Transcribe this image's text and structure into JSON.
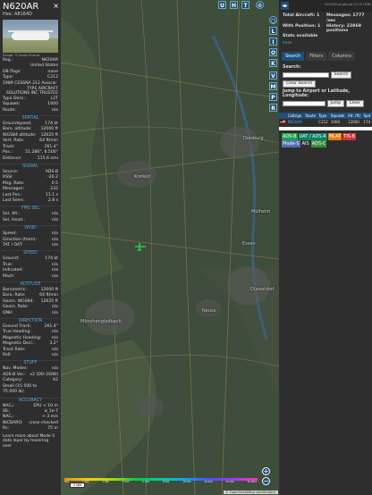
{
  "aircraft": {
    "callsign": "N620AR",
    "hex_label": "Hex:  A8164D",
    "photo_credit": "Image: © Jonas Errand"
  },
  "details": [
    {
      "k": "Reg.:",
      "v": "N620AR"
    },
    {
      "k": "",
      "v": "United States"
    },
    {
      "k": "DB flags:",
      "v": "none"
    },
    {
      "k": "Type:",
      "v": "C212"
    },
    {
      "k": "1989 CESSNA 212 Aviocar",
      "v": ""
    }
  ],
  "owner_lines": [
    "TYPE AIRCRAFT",
    "SOLUTIONS INC TRUSTEE"
  ],
  "details2": [
    {
      "k": "Type Desc.:",
      "v": "L2T"
    },
    {
      "k": "Squawk:",
      "v": "1000"
    },
    {
      "k": "Route:",
      "v": "n/a"
    }
  ],
  "sections": {
    "spatial": "SPATIAL",
    "signal": "SIGNAL",
    "fms_sel": "FMS SEL",
    "wind": "WIND",
    "speed": "SPEED",
    "altitude": "ALTITUDE",
    "direction": "DIRECTION",
    "stuff": "STUFF",
    "accuracy": "ACCURACY"
  },
  "spatial": [
    {
      "k": "Groundspeed:",
      "v": "174 kt"
    },
    {
      "k": "Baro. altitude:",
      "v": "12000 ft"
    },
    {
      "k": "WGS84 altitude:",
      "v": "12625 ft"
    },
    {
      "k": "Vert. Rate:",
      "v": "64 ft/min"
    },
    {
      "k": "Track:",
      "v": "261.4°"
    },
    {
      "k": "Pos.:",
      "v": "51.286°, 6.500°"
    },
    {
      "k": "Distance:",
      "v": "115.6 nmi"
    }
  ],
  "signal": [
    {
      "k": "Source:",
      "v": "ADS-B"
    },
    {
      "k": "RSSI:",
      "v": "-26.2"
    },
    {
      "k": "Msg. Rate:",
      "v": "0.5"
    },
    {
      "k": "Messages:",
      "v": "232"
    },
    {
      "k": "Last Pos.:",
      "v": "11.1 s"
    },
    {
      "k": "Last Seen:",
      "v": "2.8 s"
    }
  ],
  "fms": [
    {
      "k": "Sel. Alt.:",
      "v": "n/a"
    },
    {
      "k": "Sel. Head.:",
      "v": "n/a"
    }
  ],
  "wind": [
    {
      "k": "Speed:",
      "v": "n/a"
    },
    {
      "k": "Direction (from):",
      "v": "n/a"
    },
    {
      "k": "TAT / OAT:",
      "v": "n/a"
    }
  ],
  "speed": [
    {
      "k": "Ground:",
      "v": "174 kt"
    },
    {
      "k": "True:",
      "v": "n/a"
    },
    {
      "k": "Indicated:",
      "v": "n/a"
    },
    {
      "k": "Mach:",
      "v": "n/a"
    }
  ],
  "altitude": [
    {
      "k": "Barometric:",
      "v": "12000 ft"
    },
    {
      "k": "Baro. Rate:",
      "v": "64 ft/min"
    },
    {
      "k": "Geom. WGS84:",
      "v": "12625 ft"
    },
    {
      "k": "Geom. Rate:",
      "v": "n/a"
    },
    {
      "k": "QNH:",
      "v": "n/a"
    }
  ],
  "direction": [
    {
      "k": "Ground Track:",
      "v": "261.4°"
    },
    {
      "k": "True Heading:",
      "v": "n/a"
    },
    {
      "k": "Magnetic Heading:",
      "v": "n/a"
    },
    {
      "k": "Magnetic Decl.:",
      "v": "3.2°"
    },
    {
      "k": "Track Rate:",
      "v": "n/a"
    },
    {
      "k": "Roll:",
      "v": "n/a"
    }
  ],
  "stuff": [
    {
      "k": "Nav. Modes:",
      "v": "n/a"
    },
    {
      "k": "ADS-B Ver.:",
      "v": "v2 (DO-260B)"
    },
    {
      "k": "Category:",
      "v": "A2"
    },
    {
      "k": "Small (15 500 to",
      "v": ""
    },
    {
      "k": "75 000 lb)",
      "v": ""
    }
  ],
  "accuracy": [
    {
      "k": "NACₚ:",
      "v": "EPU < 10 m"
    },
    {
      "k": "SIL:",
      "v": "≤ 1e-7"
    },
    {
      "k": "NACᵥ:",
      "v": "< 3 m/s"
    },
    {
      "k": "NICBARO:",
      "v": "cross-checked"
    },
    {
      "k": "Rc:",
      "v": "75 m"
    }
  ],
  "footer_note": "Learn more about Mode S data layer by hovering over",
  "map": {
    "buttons_top": [
      "U",
      "H",
      "T"
    ],
    "side_buttons": [
      "I",
      "O",
      "K",
      "V",
      "M",
      "P",
      "R"
    ],
    "labels": [
      "Duisburg",
      "Mülheim",
      "Essen",
      "Krefeld",
      "Düsseldorf",
      "Mönchengladbach",
      "Neuss"
    ],
    "scale": "2 NM",
    "attribution": "© OpenStreetMap contributors.",
    "colorbar_ticks": [
      "500",
      "1 000",
      "2 000",
      "4 000",
      "6 000",
      "8 000",
      "10 000",
      "20 000",
      "30 000",
      "40 000+"
    ],
    "zoom_in": "+",
    "zoom_out": "−"
  },
  "right": {
    "toggle": "◂▸",
    "version": "tar1090 on github (3.14.1706)",
    "total_aircraft": "Total Aircraft: 1",
    "messages": "Messages: 1777 /sec",
    "with_position": "With Position: 1",
    "history": "History: 22869 positions",
    "stats_link_label": "Stats available",
    "stats_link": "here",
    "tabs": [
      "Search",
      "Filters",
      "Columns"
    ],
    "search_label": "Search:",
    "search_btn": "Search",
    "clear_search": "Clear Search",
    "jump_label": "Jump to Airport or Latitude, Longitude:",
    "jump_btn": "Jump",
    "clear_btn": "Clear",
    "columns": [
      "",
      "Callsign",
      "Route",
      "Type",
      "Squawk",
      "Alt. (ft)",
      "Spd"
    ],
    "rows": [
      [
        "us-flag",
        "N620AR",
        "",
        "C212",
        "1000",
        "12000",
        "174"
      ]
    ],
    "badges": [
      {
        "text": "ADS-B",
        "color": "#1aa34a"
      },
      {
        "text": "UAT / ADS-R",
        "color": "#0a7f64"
      },
      {
        "text": "MLAT",
        "color": "#e87b12"
      },
      {
        "text": "TIS-B",
        "color": "#d13535"
      },
      {
        "text": "Mode-S",
        "color": "#4f6fb0"
      },
      {
        "text": "AIS",
        "color": "#333333"
      },
      {
        "text": "ADS-C",
        "color": "#3a8f3a"
      }
    ]
  },
  "colors": {
    "accent": "#1e4e79",
    "section": "#4fa7e0",
    "plane": "#29d04a"
  }
}
